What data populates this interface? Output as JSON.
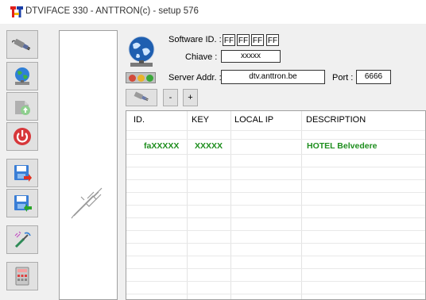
{
  "window": {
    "title": "DTVIFACE 330 - ANTTRON(c) - setup 576"
  },
  "toolbar": {
    "buttons": [
      "connect-icon",
      "web-globe-icon",
      "upload-icon",
      "power-icon",
      "save-red-icon",
      "save-green-icon",
      "antenna-icon",
      "calculator-icon"
    ]
  },
  "form": {
    "software_id_label": "Software ID. :",
    "software_id": [
      "FF",
      "FF",
      "FF",
      "FF"
    ],
    "chiave_label": "Chiave :",
    "chiave_value": "xxxxx",
    "server_label": "Server Addr. :",
    "server_value": "dtv.anttron.be",
    "port_label": "Port :",
    "port_value": "6666"
  },
  "actions": {
    "minus": "-",
    "plus": "+"
  },
  "table": {
    "columns": [
      "ID.",
      "KEY",
      "LOCAL IP",
      "DESCRIPTION"
    ],
    "rows": [
      {
        "id": "faXXXXX",
        "key": "XXXXX",
        "local_ip": "",
        "description": "HOTEL Belvedere"
      }
    ]
  },
  "colors": {
    "row_text": "#1e8e1e"
  }
}
